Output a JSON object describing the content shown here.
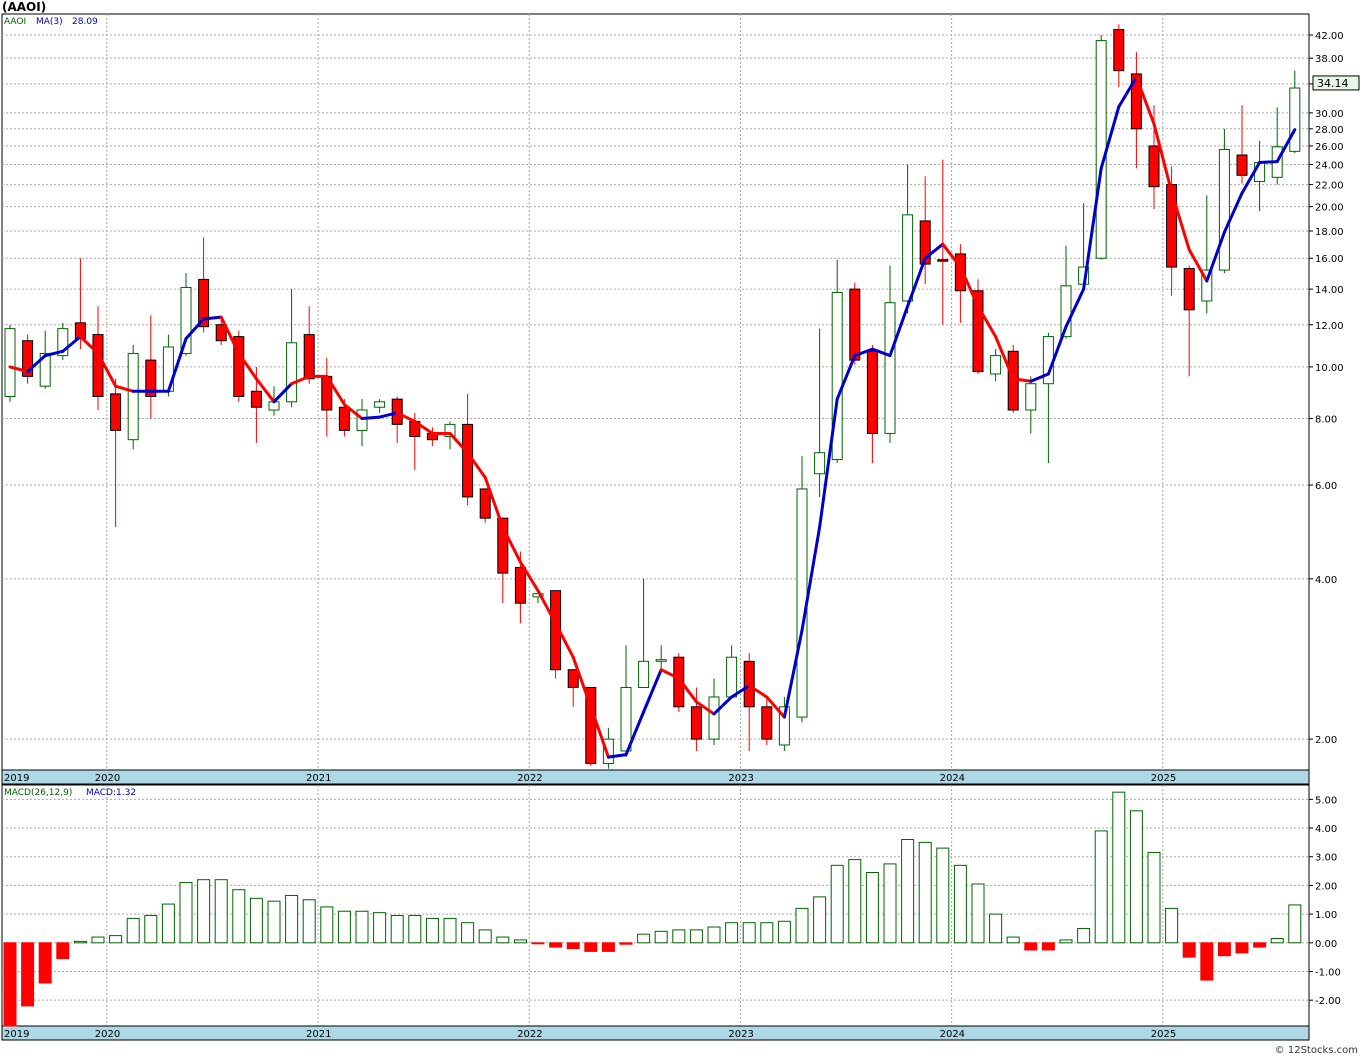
{
  "title": "(AAOI)",
  "watermark": "© 12Stocks.com",
  "price_legend": {
    "ticker": "AAOI",
    "ma": "MA(3)",
    "ma_value": "28.09"
  },
  "macd_legend": {
    "label": "MACD(26,12,9)",
    "value": "MACD:1.32"
  },
  "last_price": "34.14",
  "colors": {
    "up": "#006400",
    "down": "#ff0000",
    "ma_up": "#0000cc",
    "ma_down": "#ff0000",
    "axis_band": "#add8e6"
  },
  "chart_data": [
    {
      "type": "candlestick",
      "scale": "log",
      "ylim": [
        1.75,
        46
      ],
      "y_ticks": [
        "2.00",
        "4.00",
        "6.00",
        "8.00",
        "10.00",
        "12.00",
        "14.00",
        "16.00",
        "18.00",
        "20.00",
        "22.00",
        "24.00",
        "26.00",
        "28.00",
        "30.00",
        "34.00",
        "38.00",
        "42.00"
      ],
      "x_tick_labels": [
        "2019",
        "2020",
        "2021",
        "2022",
        "2023",
        "2024",
        "2025"
      ],
      "candles": [
        [
          8.8,
          11.8,
          8.6,
          12.0
        ],
        [
          11.2,
          9.6,
          9.3,
          11.5
        ],
        [
          9.2,
          10.6,
          9.1,
          11.7
        ],
        [
          10.5,
          11.8,
          10.3,
          12.1
        ],
        [
          12.1,
          11.3,
          10.8,
          16.0
        ],
        [
          11.5,
          8.8,
          8.3,
          13.0
        ],
        [
          8.9,
          7.6,
          5.0,
          9.5
        ],
        [
          7.3,
          10.6,
          7.0,
          11.0
        ],
        [
          10.3,
          8.8,
          8.0,
          12.5
        ],
        [
          9.0,
          10.9,
          8.8,
          11.5
        ],
        [
          10.6,
          14.1,
          10.5,
          15.0
        ],
        [
          14.6,
          11.9,
          11.6,
          17.5
        ],
        [
          12.0,
          11.2,
          11.0,
          12.4
        ],
        [
          11.4,
          8.8,
          8.6,
          11.7
        ],
        [
          9.0,
          8.4,
          7.2,
          10.0
        ],
        [
          8.3,
          8.6,
          8.1,
          9.2
        ],
        [
          8.6,
          11.1,
          8.4,
          14.0
        ],
        [
          11.5,
          9.5,
          9.3,
          13.0
        ],
        [
          9.6,
          8.3,
          7.4,
          10.4
        ],
        [
          8.4,
          7.6,
          7.4,
          8.7
        ],
        [
          7.6,
          8.3,
          7.1,
          8.7
        ],
        [
          8.4,
          8.6,
          8.2,
          8.7
        ],
        [
          8.7,
          7.8,
          7.2,
          8.8
        ],
        [
          7.9,
          7.4,
          6.4,
          8.2
        ],
        [
          7.5,
          7.3,
          7.1,
          7.7
        ],
        [
          7.4,
          7.8,
          7.0,
          7.9
        ],
        [
          7.8,
          5.7,
          5.5,
          8.9
        ],
        [
          5.9,
          5.2,
          5.1,
          5.9
        ],
        [
          5.2,
          4.1,
          3.6,
          5.2
        ],
        [
          4.2,
          3.6,
          3.3,
          4.5
        ],
        [
          3.7,
          3.75,
          3.6,
          3.75
        ],
        [
          3.8,
          2.7,
          2.6,
          3.8
        ],
        [
          2.7,
          2.5,
          2.3,
          2.7
        ],
        [
          2.5,
          1.8,
          1.78,
          2.5
        ],
        [
          1.8,
          2.0,
          1.76,
          2.1
        ],
        [
          1.9,
          2.5,
          1.85,
          3.0
        ],
        [
          2.5,
          2.8,
          2.5,
          4.0
        ],
        [
          2.8,
          2.82,
          2.7,
          3.0
        ],
        [
          2.85,
          2.3,
          2.25,
          2.9
        ],
        [
          2.3,
          2.0,
          1.9,
          2.5
        ],
        [
          2.0,
          2.4,
          1.95,
          2.6
        ],
        [
          2.4,
          2.85,
          2.4,
          3.0
        ],
        [
          2.8,
          2.3,
          1.9,
          2.9
        ],
        [
          2.3,
          2.0,
          1.95,
          2.4
        ],
        [
          1.95,
          2.3,
          1.9,
          2.4
        ],
        [
          2.2,
          5.9,
          2.15,
          6.8
        ],
        [
          6.3,
          6.9,
          5.7,
          11.8
        ],
        [
          6.7,
          13.8,
          6.6,
          15.9
        ],
        [
          14.0,
          10.3,
          10.1,
          14.4
        ],
        [
          10.7,
          7.5,
          6.6,
          11.0
        ],
        [
          7.5,
          13.2,
          7.2,
          15.5
        ],
        [
          13.3,
          19.3,
          12.6,
          24.0
        ],
        [
          18.8,
          15.6,
          14.3,
          22.8
        ],
        [
          15.9,
          15.8,
          12.0,
          24.5
        ],
        [
          16.3,
          13.9,
          12.1,
          17.0
        ],
        [
          13.9,
          9.8,
          9.7,
          14.6
        ],
        [
          9.7,
          10.5,
          9.4,
          10.8
        ],
        [
          10.7,
          8.3,
          8.2,
          11.0
        ],
        [
          8.3,
          9.3,
          7.5,
          9.6
        ],
        [
          9.3,
          11.4,
          6.6,
          11.6
        ],
        [
          11.4,
          14.2,
          11.3,
          16.9
        ],
        [
          14.3,
          15.4,
          14.2,
          20.3
        ],
        [
          16.0,
          41.0,
          15.9,
          42.0
        ],
        [
          43.0,
          36.0,
          33.5,
          44.0
        ],
        [
          35.5,
          28.0,
          23.6,
          39.0
        ],
        [
          26.0,
          21.8,
          19.8,
          31.0
        ],
        [
          22.0,
          15.4,
          13.6,
          23.8
        ],
        [
          15.3,
          12.8,
          9.6,
          15.5
        ],
        [
          13.3,
          15.2,
          12.6,
          21.0
        ],
        [
          15.2,
          25.6,
          15.0,
          28.0
        ],
        [
          25.0,
          22.9,
          22.1,
          31.0
        ],
        [
          22.3,
          24.2,
          19.6,
          26.6
        ],
        [
          22.7,
          25.9,
          22.0,
          30.7
        ],
        [
          25.4,
          33.4,
          25.2,
          36.0
        ]
      ],
      "ma3": [
        10.0,
        9.8,
        10.5,
        10.7,
        11.4,
        10.6,
        9.2,
        9.0,
        9.0,
        9.0,
        11.3,
        12.3,
        12.4,
        10.6,
        9.5,
        8.6,
        9.3,
        9.6,
        9.6,
        8.5,
        8.0,
        8.05,
        8.2,
        7.9,
        7.5,
        7.5,
        6.9,
        6.2,
        5.0,
        4.3,
        3.8,
        3.3,
        2.85,
        2.3,
        1.85,
        1.87,
        2.25,
        2.7,
        2.6,
        2.35,
        2.23,
        2.4,
        2.52,
        2.4,
        2.2,
        3.2,
        5.0,
        8.7,
        10.5,
        10.8,
        10.5,
        13.0,
        16.0,
        17.0,
        15.4,
        13.0,
        11.4,
        9.5,
        9.4,
        9.7,
        11.9,
        14.0,
        23.6,
        30.8,
        35.0,
        28.6,
        21.3,
        16.6,
        14.5,
        17.9,
        21.2,
        24.2,
        24.3,
        27.9
      ],
      "ma3_dir": [
        0,
        0,
        1,
        1,
        1,
        0,
        0,
        0,
        1,
        1,
        1,
        1,
        1,
        0,
        0,
        0,
        1,
        0,
        0,
        0,
        0,
        1,
        1,
        0,
        0,
        0,
        0,
        0,
        0,
        0,
        0,
        0,
        0,
        0,
        0,
        1,
        1,
        1,
        0,
        0,
        0,
        1,
        1,
        0,
        0,
        1,
        1,
        1,
        1,
        1,
        1,
        1,
        1,
        1,
        0,
        0,
        0,
        0,
        0,
        1,
        1,
        1,
        1,
        1,
        1,
        0,
        0,
        0,
        0,
        1,
        1,
        1,
        1,
        1
      ]
    },
    {
      "type": "bar",
      "ylim": [
        -2.9,
        5.5
      ],
      "y_ticks": [
        "-2.00",
        "-1.00",
        "0.00",
        "1.00",
        "2.00",
        "3.00",
        "4.00",
        "5.00"
      ],
      "x_tick_labels": [
        "2019",
        "2020",
        "2021",
        "2022",
        "2023",
        "2024",
        "2025"
      ],
      "values": [
        -2.9,
        -2.2,
        -1.4,
        -0.55,
        0.05,
        0.2,
        0.25,
        0.85,
        0.95,
        1.35,
        2.1,
        2.2,
        2.2,
        1.85,
        1.55,
        1.45,
        1.65,
        1.5,
        1.25,
        1.1,
        1.1,
        1.05,
        0.95,
        0.95,
        0.85,
        0.85,
        0.7,
        0.45,
        0.2,
        0.1,
        -0.02,
        -0.15,
        -0.2,
        -0.3,
        -0.3,
        -0.05,
        0.3,
        0.4,
        0.45,
        0.45,
        0.55,
        0.7,
        0.7,
        0.7,
        0.75,
        1.2,
        1.6,
        2.7,
        2.9,
        2.45,
        2.75,
        3.6,
        3.5,
        3.3,
        2.7,
        2.05,
        1.0,
        0.2,
        -0.25,
        -0.25,
        0.1,
        0.5,
        3.9,
        5.25,
        4.6,
        3.15,
        1.2,
        -0.5,
        -1.3,
        -0.45,
        -0.35,
        -0.15,
        0.15,
        1.32
      ]
    }
  ]
}
